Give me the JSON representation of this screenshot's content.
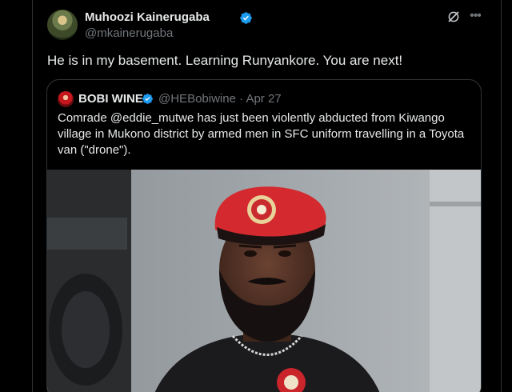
{
  "author": {
    "name": "Muhoozi Kainerugaba",
    "handle": "@mkainerugaba"
  },
  "tweet": {
    "text": "He is in my basement. Learning Runyankore. You are next!"
  },
  "quoted": {
    "name": "BOBI WINE",
    "handle": "@HEBobiwine",
    "separator": "·",
    "date": "Apr 27",
    "text": "Comrade @eddie_mutwe has just been violently abducted from Kiwango village in Mukono district by armed men in SFC uniform travelling in a Toyota van (\"drone\")."
  },
  "icons": {
    "verified": "verified-badge-icon",
    "grok": "grok-icon",
    "more": "more-icon"
  },
  "colors": {
    "background": "#000000",
    "text": "#e7e9ea",
    "muted": "#71767b",
    "border": "#2f3336",
    "verified": "#1d9bf0",
    "beret": "#d42a2f"
  }
}
